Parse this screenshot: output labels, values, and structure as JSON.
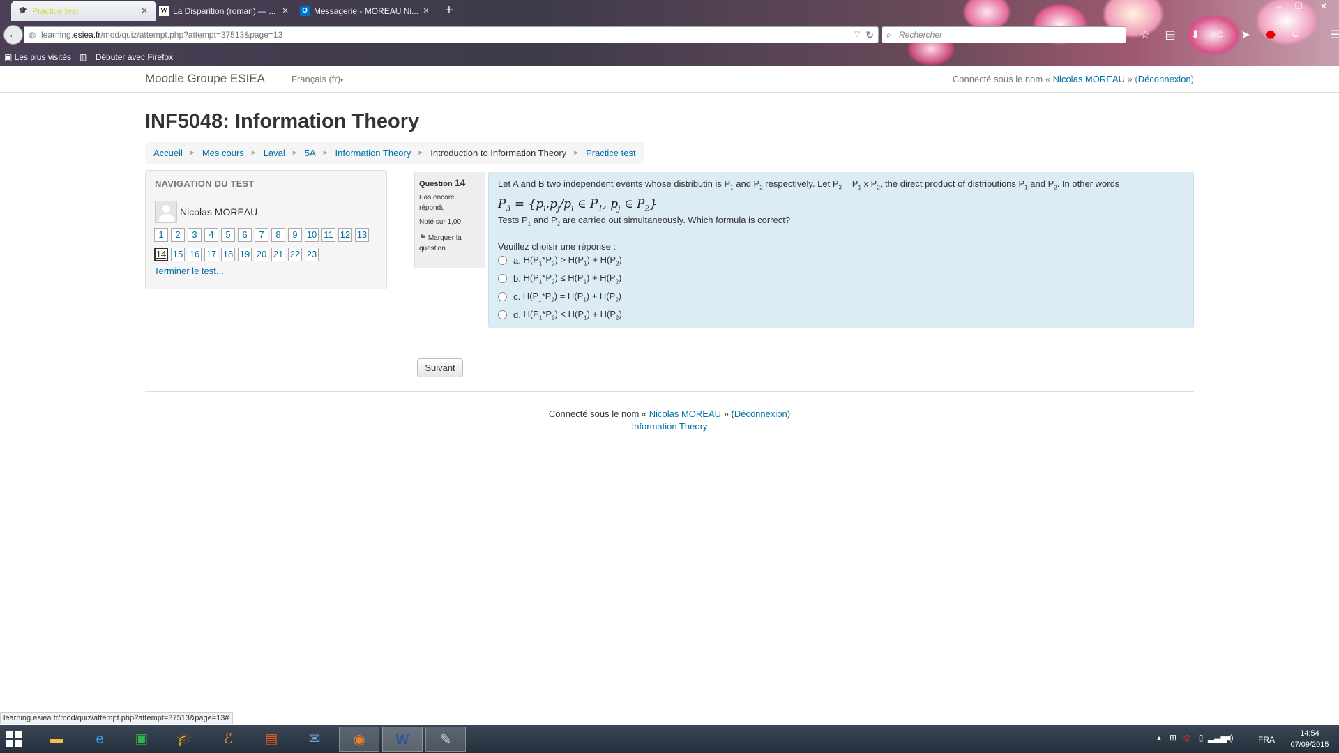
{
  "browser": {
    "tabs": [
      {
        "label": "Practice test",
        "icon": "moodle-favicon-icon",
        "active": true
      },
      {
        "label": "La Disparition (roman) — ...",
        "icon": "wikipedia-w-icon",
        "active": false
      },
      {
        "label": "Messagerie - MOREAU Ni...",
        "icon": "outlook-icon",
        "active": false
      }
    ],
    "url_prefix": "learning.",
    "url_domain": "esiea.fr",
    "url_path": "/mod/quiz/attempt.php?attempt=37513&page=13",
    "search_placeholder": "Rechercher",
    "bookmarks": [
      "Les plus visités",
      "Débuter avec Firefox"
    ]
  },
  "site": {
    "brand": "Moodle Groupe ESIEA",
    "language": "Français (fr)",
    "login_prefix": "Connecté sous le nom « ",
    "user": "Nicolas MOREAU",
    "login_mid": " » (",
    "logout": "Déconnexion",
    "login_suffix": ")"
  },
  "course_title": "INF5048: Information Theory",
  "breadcrumb": [
    {
      "label": "Accueil",
      "link": true
    },
    {
      "label": "Mes cours",
      "link": true
    },
    {
      "label": "Laval",
      "link": true
    },
    {
      "label": "5A",
      "link": true
    },
    {
      "label": "Information Theory",
      "link": true
    },
    {
      "label": "Introduction to Information Theory",
      "link": false
    },
    {
      "label": "Practice test",
      "link": true
    }
  ],
  "quiz_nav": {
    "heading": "NAVIGATION DU TEST",
    "user": "Nicolas MOREAU",
    "questions": [
      "1",
      "2",
      "3",
      "4",
      "5",
      "6",
      "7",
      "8",
      "9",
      "10",
      "11",
      "12",
      "13",
      "14",
      "15",
      "16",
      "17",
      "18",
      "19",
      "20",
      "21",
      "22",
      "23"
    ],
    "current": "14",
    "finish": "Terminer le test..."
  },
  "question_info": {
    "label": "Question",
    "number": "14",
    "state": "Pas encore répondu",
    "grade": "Noté sur 1,00",
    "flag": "Marquer la question"
  },
  "question": {
    "prompt_label": "Veuillez choisir une réponse :",
    "options": [
      {
        "letter": "a.",
        "relation": ">"
      },
      {
        "letter": "b.",
        "relation": "≤"
      },
      {
        "letter": "c.",
        "relation": "="
      },
      {
        "letter": "d.",
        "relation": "<"
      }
    ]
  },
  "next_button": "Suivant",
  "footer": {
    "course_link": "Information Theory"
  },
  "status_url": "learning.esiea.fr/mod/quiz/attempt.php?attempt=37513&page=13#",
  "taskbar": {
    "language": "FRA",
    "time": "14:54",
    "date": "07/09/2015"
  }
}
